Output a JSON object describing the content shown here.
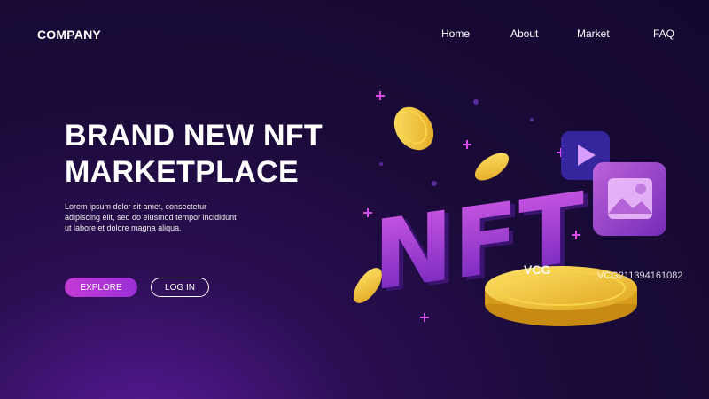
{
  "header": {
    "brand": "COMPANY",
    "nav": [
      "Home",
      "About",
      "Market",
      "FAQ"
    ]
  },
  "hero": {
    "headline_line1": "BRAND NEW NFT",
    "headline_line2": "MARKETPLACE",
    "description": "Lorem ipsum dolor sit amet, consectetur adipiscing elit, sed do eiusmod tempor incididunt ut labore et dolore magna aliqua.",
    "explore_label": "EXPLORE",
    "login_label": "LOG IN"
  },
  "illustration": {
    "nft_text": "NFT",
    "icons": [
      "play-icon",
      "image-icon",
      "coin-icon",
      "plus-icon"
    ]
  },
  "watermark": {
    "logo": "VCG",
    "id": "VCG211394161082"
  },
  "colors": {
    "background": "#1a0a38",
    "accent": "#c23bd4",
    "gold": "#f2c230"
  }
}
